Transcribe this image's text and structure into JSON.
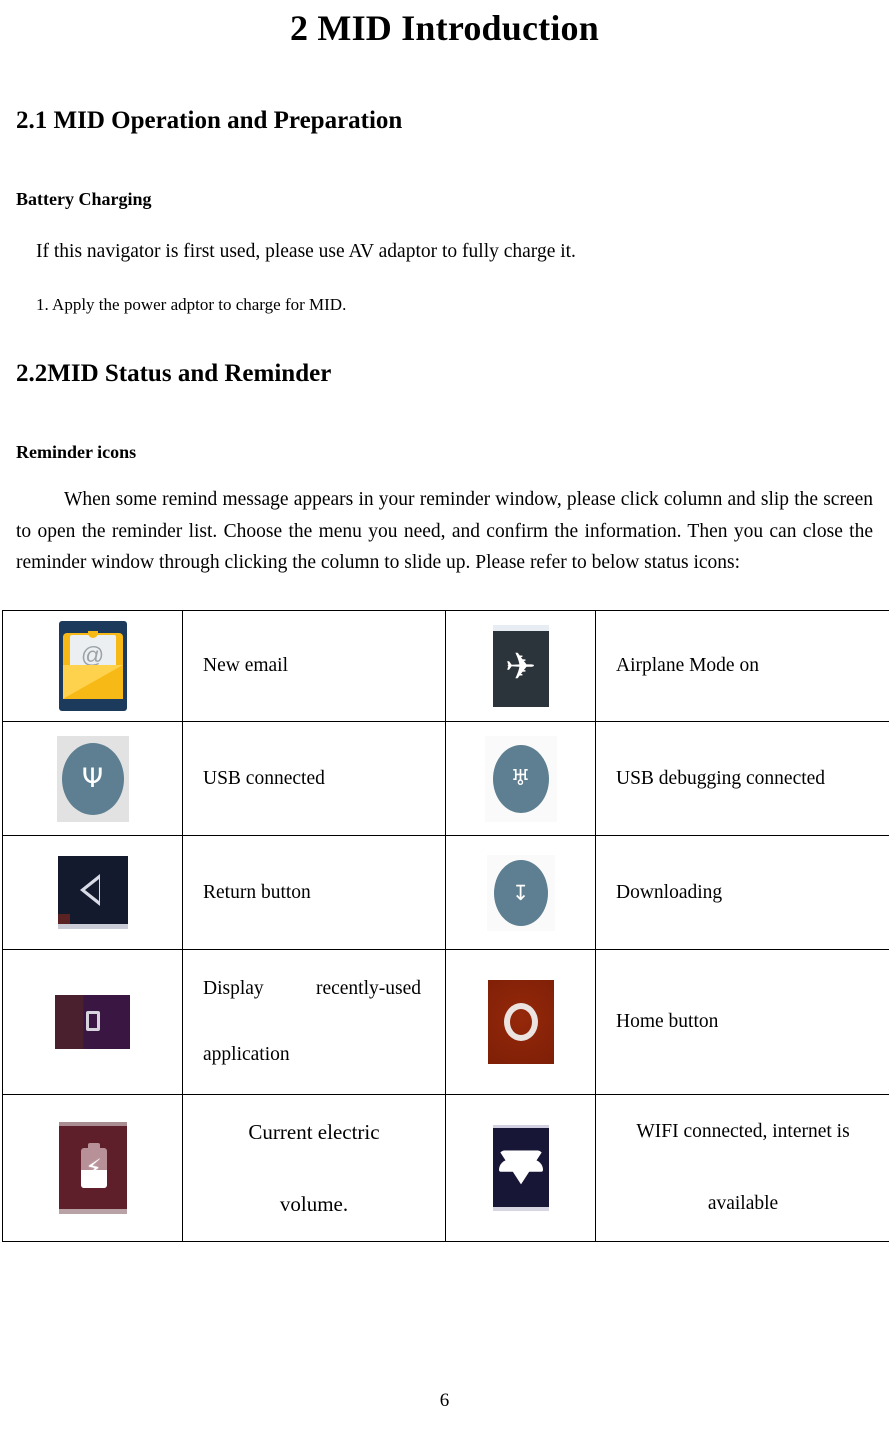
{
  "document": {
    "title": "2 MID Introduction",
    "page_number": "6"
  },
  "sections": [
    {
      "heading": "2.1 MID Operation and Preparation",
      "subheading": "Battery Charging",
      "paragraphs": [
        "If this navigator is first used, please use AV adaptor to fully charge it.",
        "1. Apply the power adptor to charge for MID."
      ]
    },
    {
      "heading": "2.2MID Status and Reminder",
      "subheading": "Reminder icons",
      "paragraphs": [
        "When some remind message appears in your reminder window, please click column and slip the screen to open the reminder list. Choose the menu you need, and confirm the information. Then you can close the reminder window through clicking the column to slide up. Please refer to below status icons:"
      ]
    }
  ],
  "status_icon_table": {
    "rows": [
      {
        "left": {
          "icon": "new-email-icon",
          "label": "New email"
        },
        "right": {
          "icon": "airplane-mode-icon",
          "label": "Airplane Mode on"
        }
      },
      {
        "left": {
          "icon": "usb-connected-icon",
          "label": "USB connected"
        },
        "right": {
          "icon": "usb-debugging-icon",
          "label": "USB debugging connected"
        }
      },
      {
        "left": {
          "icon": "return-button-icon",
          "label": "Return button"
        },
        "right": {
          "icon": "downloading-icon",
          "label": "Downloading"
        }
      },
      {
        "left": {
          "icon": "recent-apps-icon",
          "label": "Display recently-used application"
        },
        "right": {
          "icon": "home-button-icon",
          "label": "Home button"
        }
      },
      {
        "left": {
          "icon": "battery-charging-icon",
          "label_line1": "Current electric",
          "label_line2": "volume."
        },
        "right": {
          "icon": "wifi-connected-icon",
          "label_line1": "WIFI connected, internet is",
          "label_line2": "available"
        }
      }
    ]
  },
  "glyphs": {
    "airplane": "✈",
    "usb": "Ψ",
    "android": "♅",
    "download": "↧",
    "bolt": "⚡"
  },
  "colors": {
    "email_bg": "#1b3a5c",
    "email_envelope": "#f7b915",
    "airplane_bg": "#2b333b",
    "usb_circle": "#5d7f91",
    "return_bg": "#131a2e",
    "recents_bg": "#3a1642",
    "home_bg": "#8a2408",
    "battery_bg": "#5e1f2b",
    "wifi_bg": "#171636"
  }
}
